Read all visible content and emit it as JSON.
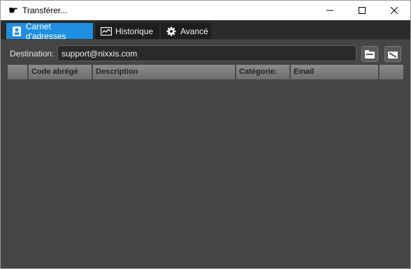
{
  "window": {
    "title": "Transférer..."
  },
  "tabs": [
    {
      "label": "Carnet d'adresses",
      "icon": "address-book-icon"
    },
    {
      "label": "Historique",
      "icon": "history-icon"
    },
    {
      "label": "Avancé",
      "icon": "gear-icon"
    }
  ],
  "destination": {
    "label": "Destination:",
    "value": "support@nixxis.com"
  },
  "table": {
    "columns": [
      "",
      "Code abrégé",
      "Description",
      "Catégorie:",
      "Email",
      ""
    ],
    "rows": []
  },
  "colors": {
    "accent": "#1f8fe0",
    "background": "#454545",
    "tab_bar": "#2b2b2b"
  }
}
